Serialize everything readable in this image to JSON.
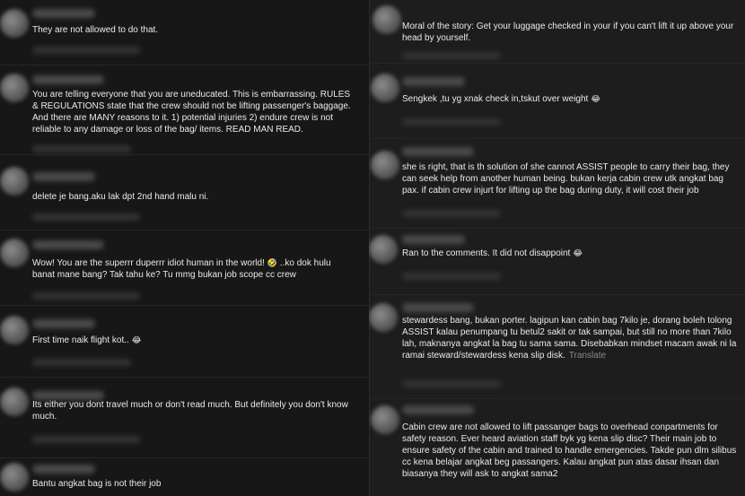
{
  "left_comments": [
    {
      "text": "They are not allowed to do that."
    },
    {
      "text": "You are telling everyone that you are uneducated. This is embarrassing. RULES & REGULATIONS state that the crew should not be lifting passenger's baggage. And there are MANY reasons to it. 1) potential injuries 2) endure crew is not reliable to any damage or loss of the bag/ items. READ MAN READ."
    },
    {
      "text": "delete je bang.aku lak dpt 2nd hand malu ni."
    },
    {
      "text": "Wow! You are the superrr duperrr idiot human in the world!",
      "emoji": "🤣",
      "text2": "..ko dok hulu banat mane bang? Tak tahu ke? Tu mmg bukan job scope cc crew"
    },
    {
      "text": "First time naik flight kot..",
      "emoji": "😂"
    },
    {
      "text": "Its either you dont travel much or don't read much. But definitely you don't know much."
    },
    {
      "text": "Bantu angkat bag is not their job"
    }
  ],
  "right_comments": [
    {
      "text": "Moral of the story: Get your luggage checked in your if you can't lift it up above your head by yourself."
    },
    {
      "text": "Sengkek ,tu yg xnak check in,tskut over weight",
      "emoji": "😂"
    },
    {
      "text": "she is right, that is th solution of she cannot ASSIST people to carry their bag, they can seek help from another human being. bukan kerja cabin crew utk angkat bag pax. if cabin crew injurt for lifting up the bag during duty, it will cost their job"
    },
    {
      "text": "Ran to the comments. It did not disappoint",
      "emoji": "😂"
    },
    {
      "text": "stewardess bang, bukan porter. lagipun kan cabin bag 7kilo je, dorang boleh tolong ASSIST kalau penumpang tu betul2 sakit or tak sampai, but still no more than 7kilo lah, maknanya angkat la bag tu sama sama. Disebabkan mindset macam awak ni la ramai steward/stewardess kena slip disk.",
      "translate": "Translate"
    },
    {
      "text": "Cabin crew are not allowed to lift passanger bags to overhead conpartments for safety reason. Ever heard aviation staff byk yg kena slip disc? Their main job to ensure safety of the cabin and trained to handle emergencies. Takde pun dlm silibus cc kena belajar angkat beg passangers. Kalau angkat pun atas dasar ihsan dan biasanya they will ask to angkat sama2"
    }
  ],
  "colors": {
    "left_bg": "#171717",
    "right_bg": "#1d1d1d",
    "text": "#eaeaea",
    "translate": "#8a8a8a"
  }
}
